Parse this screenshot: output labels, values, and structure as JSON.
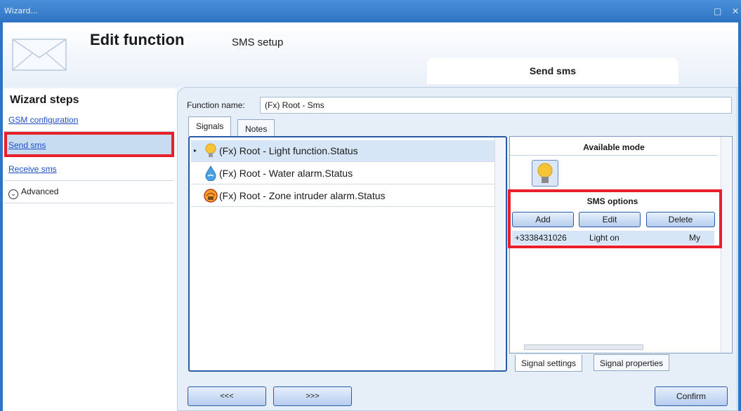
{
  "window": {
    "title": "Wizard...",
    "maximize_glyph": "□",
    "close_glyph": "✕"
  },
  "header": {
    "title": "Edit function",
    "subtitle": "SMS setup",
    "tab_label": "Send sms"
  },
  "wizard": {
    "title": "Wizard steps",
    "steps": [
      {
        "label": "GSM configuration"
      },
      {
        "label": "Send sms"
      },
      {
        "label": "Receive sms"
      },
      {
        "label": "Advanced"
      }
    ]
  },
  "function": {
    "label": "Function name:",
    "value": "(Fx) Root - Sms"
  },
  "tabs": {
    "signals": "Signals",
    "notes": "Notes"
  },
  "signals": [
    {
      "label": "(Fx) Root - Light function.Status",
      "icon": "light-bulb-icon"
    },
    {
      "label": "(Fx) Root - Water alarm.Status",
      "icon": "water-drop-icon"
    },
    {
      "label": "(Fx) Root - Zone intruder alarm.Status",
      "icon": "intruder-alarm-icon"
    }
  ],
  "available_mode": {
    "title": "Available mode"
  },
  "sms_options": {
    "title": "SMS options",
    "add": "Add",
    "edit": "Edit",
    "delete": "Delete",
    "row": {
      "number": "+3338431026",
      "message": "Light on",
      "extra": "My"
    }
  },
  "bottom_tabs": {
    "settings": "Signal settings",
    "properties": "Signal properties"
  },
  "nav": {
    "prev": "<<<",
    "next": ">>>",
    "confirm": "Confirm"
  },
  "colors": {
    "accent": "#2f74c4",
    "highlight": "#e8202a",
    "selected": "#c7dbf1"
  }
}
